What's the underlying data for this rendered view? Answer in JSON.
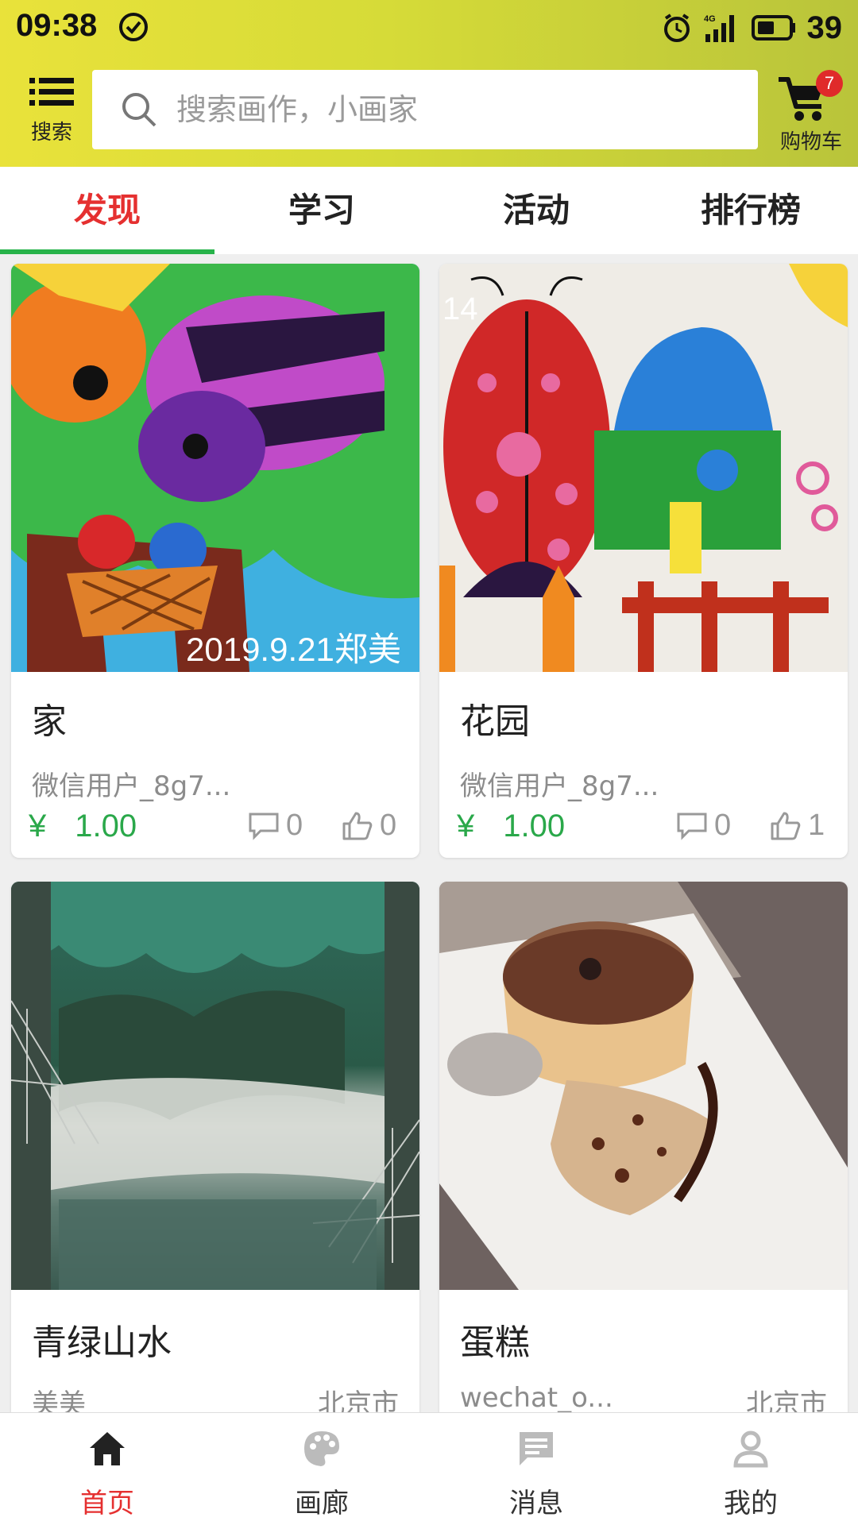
{
  "status_bar": {
    "time": "09:38",
    "network": "4G",
    "battery": "39"
  },
  "header": {
    "menu_label": "搜索",
    "search_placeholder": "搜索画作，小画家",
    "cart_label": "购物车",
    "cart_count": "7",
    "accent_color": "#d9dc3a"
  },
  "tabs": [
    {
      "label": "发现",
      "active": true
    },
    {
      "label": "学习",
      "active": false
    },
    {
      "label": "活动",
      "active": false
    },
    {
      "label": "排行榜",
      "active": false
    }
  ],
  "cards": [
    {
      "title": "家",
      "author": "微信用户_8g7...",
      "currency": "¥",
      "price": "1.00",
      "comments": "0",
      "likes": "0",
      "image": "crayon drawing of birds in a tree",
      "overlay_text": "2019.9.21郑美"
    },
    {
      "title": "花园",
      "author": "微信用户_8g7...",
      "currency": "¥",
      "price": "1.00",
      "comments": "0",
      "likes": "1",
      "image": "crayon drawing of ladybug and house",
      "overlay_text": "14"
    },
    {
      "title": "青绿山水",
      "author": "美美",
      "city": "北京市",
      "image": "misty green landscape painting"
    },
    {
      "title": "蛋糕",
      "author": "wechat_o...",
      "city": "北京市",
      "image": "photo of cake on a plate"
    }
  ],
  "bottom_nav": [
    {
      "label": "首页",
      "icon": "home-icon",
      "active": true
    },
    {
      "label": "画廊",
      "icon": "palette-icon",
      "active": false
    },
    {
      "label": "消息",
      "icon": "message-icon",
      "active": false
    },
    {
      "label": "我的",
      "icon": "profile-icon",
      "active": false
    }
  ],
  "colors": {
    "active_red": "#e53030",
    "price_green": "#2aa84a",
    "tab_underline": "#27b34a"
  }
}
